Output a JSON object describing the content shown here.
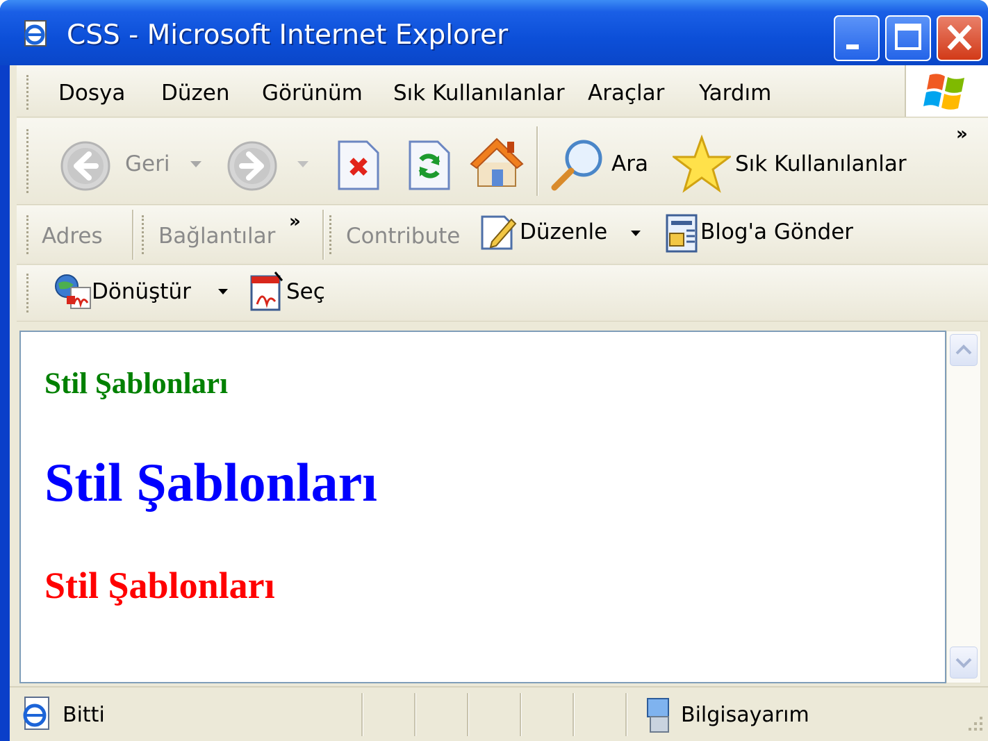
{
  "window": {
    "title": "CSS - Microsoft Internet Explorer"
  },
  "menu": {
    "items": [
      {
        "label": "Dosya"
      },
      {
        "label": "Düzen"
      },
      {
        "label": "Görünüm"
      },
      {
        "label": "Sık Kullanılanlar"
      },
      {
        "label": "Araçlar"
      },
      {
        "label": "Yardım"
      }
    ]
  },
  "toolbar": {
    "back_label": "Geri",
    "search_label": "Ara",
    "favorites_label": "Sık Kullanılanlar",
    "chevron": "»"
  },
  "addressbar": {
    "address_label": "Adres",
    "links_label": "Bağlantılar",
    "chevron": "»",
    "contribute_label": "Contribute",
    "edit_label": "Düzenle",
    "blog_label": "Blog'a Gönder"
  },
  "pdfbar": {
    "convert_label": "Dönüştür",
    "select_label": "Seç"
  },
  "content": {
    "headings": [
      {
        "text": "Stil Şablonları",
        "color": "#008000"
      },
      {
        "text": "Stil Şablonları",
        "color": "#0000ff"
      },
      {
        "text": "Stil Şablonları",
        "color": "#ff0000"
      }
    ]
  },
  "status": {
    "text": "Bitti",
    "zone": "Bilgisayarım"
  }
}
